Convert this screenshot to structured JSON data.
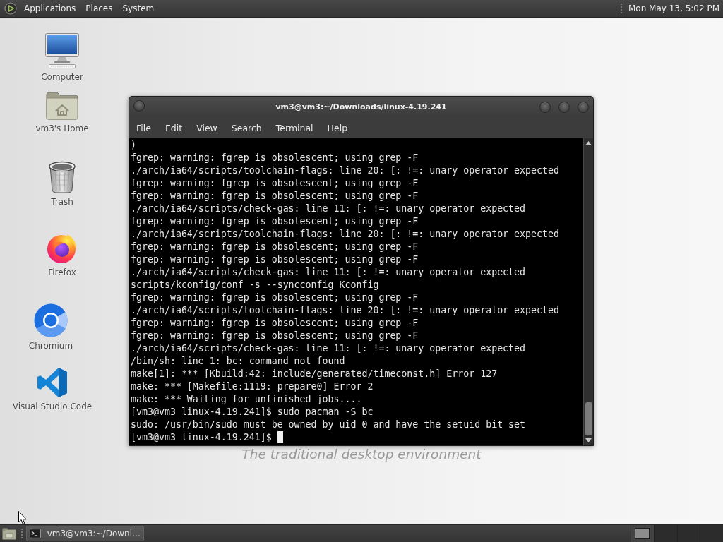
{
  "top_panel": {
    "menus": [
      "Applications",
      "Places",
      "System"
    ],
    "clock": "Mon May 13, 5:02 PM"
  },
  "desktop_icons": [
    {
      "kind": "computer",
      "label": "Computer"
    },
    {
      "kind": "home",
      "label": "vm3's Home"
    },
    {
      "kind": "trash",
      "label": "Trash"
    },
    {
      "kind": "firefox",
      "label": "Firefox"
    },
    {
      "kind": "chromium",
      "label": "Chromium"
    },
    {
      "kind": "vscode",
      "label": "Visual Studio Code"
    }
  ],
  "wallpaper_text": "The traditional desktop environment",
  "terminal": {
    "title": "vm3@vm3:~/Downloads/linux-4.19.241",
    "menu": [
      "File",
      "Edit",
      "View",
      "Search",
      "Terminal",
      "Help"
    ],
    "lines": [
      ")",
      "fgrep: warning: fgrep is obsolescent; using grep -F",
      "./arch/ia64/scripts/toolchain-flags: line 20: [: !=: unary operator expected",
      "fgrep: warning: fgrep is obsolescent; using grep -F",
      "fgrep: warning: fgrep is obsolescent; using grep -F",
      "./arch/ia64/scripts/check-gas: line 11: [: !=: unary operator expected",
      "fgrep: warning: fgrep is obsolescent; using grep -F",
      "./arch/ia64/scripts/toolchain-flags: line 20: [: !=: unary operator expected",
      "fgrep: warning: fgrep is obsolescent; using grep -F",
      "fgrep: warning: fgrep is obsolescent; using grep -F",
      "./arch/ia64/scripts/check-gas: line 11: [: !=: unary operator expected",
      "scripts/kconfig/conf -s --syncconfig Kconfig",
      "fgrep: warning: fgrep is obsolescent; using grep -F",
      "./arch/ia64/scripts/toolchain-flags: line 20: [: !=: unary operator expected",
      "fgrep: warning: fgrep is obsolescent; using grep -F",
      "fgrep: warning: fgrep is obsolescent; using grep -F",
      "./arch/ia64/scripts/check-gas: line 11: [: !=: unary operator expected",
      "/bin/sh: line 1: bc: command not found",
      "make[1]: *** [Kbuild:42: include/generated/timeconst.h] Error 127",
      "make: *** [Makefile:1119: prepare0] Error 2",
      "make: *** Waiting for unfinished jobs....",
      "[vm3@vm3 linux-4.19.241]$ sudo pacman -S bc",
      "sudo: /usr/bin/sudo must be owned by uid 0 and have the setuid bit set",
      "[vm3@vm3 linux-4.19.241]$"
    ]
  },
  "taskbar": {
    "tasks": [
      {
        "label": "vm3@vm3:~/Downl…",
        "selected": true
      }
    ],
    "workspaces": [
      {
        "selected": true
      },
      {
        "selected": false
      },
      {
        "selected": false
      },
      {
        "selected": false
      }
    ]
  }
}
